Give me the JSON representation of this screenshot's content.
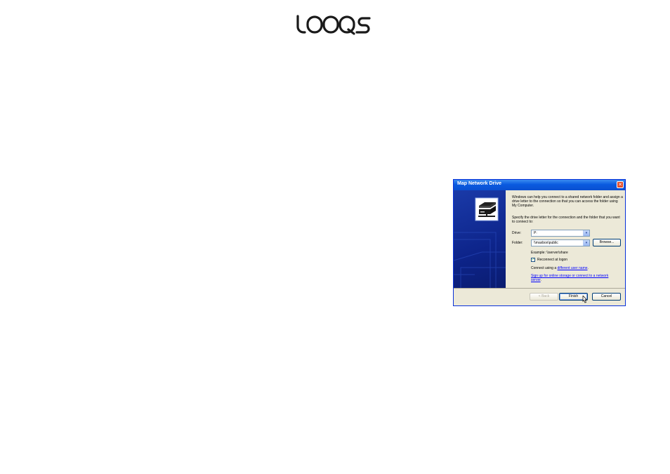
{
  "logo": {
    "text": "LOOQS"
  },
  "dialog": {
    "title": "Map Network Drive",
    "close_glyph": "✕",
    "intro_text": "Windows can help you connect to a shared network folder and assign a drive letter to the connection so that you can access the folder using My Computer.",
    "specify_text": "Specify the drive letter for the connection and the folder that you want to connect to:",
    "drive": {
      "label": "Drive:",
      "value": "P:"
    },
    "folder": {
      "label": "Folder:",
      "value": "\\\\maxbox\\public"
    },
    "browse_label": "Browse...",
    "example_text": "Example: \\\\server\\share",
    "reconnect": {
      "label": "Reconnect at logon",
      "checked": true,
      "check_glyph": "✓"
    },
    "connect_prefix": "Connect using a ",
    "connect_link": "different user name",
    "connect_suffix": ".",
    "signup_link": "Sign up for online storage or connect to a network server",
    "signup_suffix": ".",
    "buttons": {
      "back": "< Back",
      "finish": "Finish",
      "cancel": "Cancel"
    },
    "combo_arrow": "▾"
  },
  "colors": {
    "titlebar": "#0a5ae0",
    "side_panel": "#0d248a",
    "dialog_body": "#ece9d8",
    "link": "#0000ff"
  },
  "icons": [
    "close-icon",
    "network-drive-icon",
    "dropdown-arrow-icon",
    "checkmark-icon",
    "mouse-cursor-icon"
  ]
}
